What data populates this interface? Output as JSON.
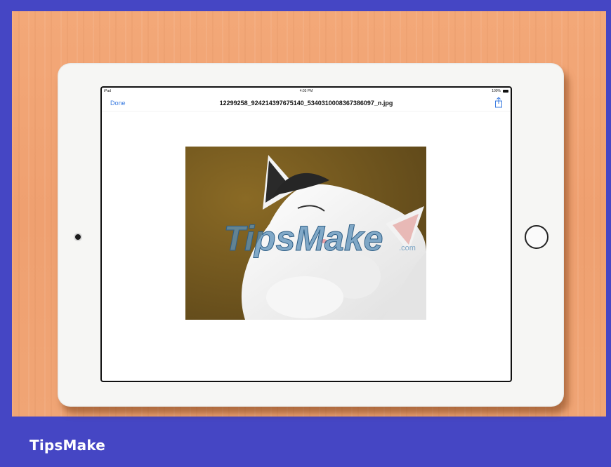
{
  "status_bar": {
    "carrier": "iPad",
    "time": "4:03 PM",
    "battery": "100%"
  },
  "nav": {
    "done_label": "Done",
    "file_title": "12299258_924214397675140_5340310008367386097_n.jpg",
    "share_icon": "share-icon"
  },
  "image": {
    "subject": "cat-photo",
    "watermark_text": "TipsMake",
    "watermark_suffix": ".com"
  },
  "footer": {
    "brand": "TipsMake"
  },
  "colors": {
    "background": "#4546c4",
    "wood": "#f0a575",
    "ipad_frame": "#f6f6f4",
    "link_blue": "#3a7be0"
  }
}
